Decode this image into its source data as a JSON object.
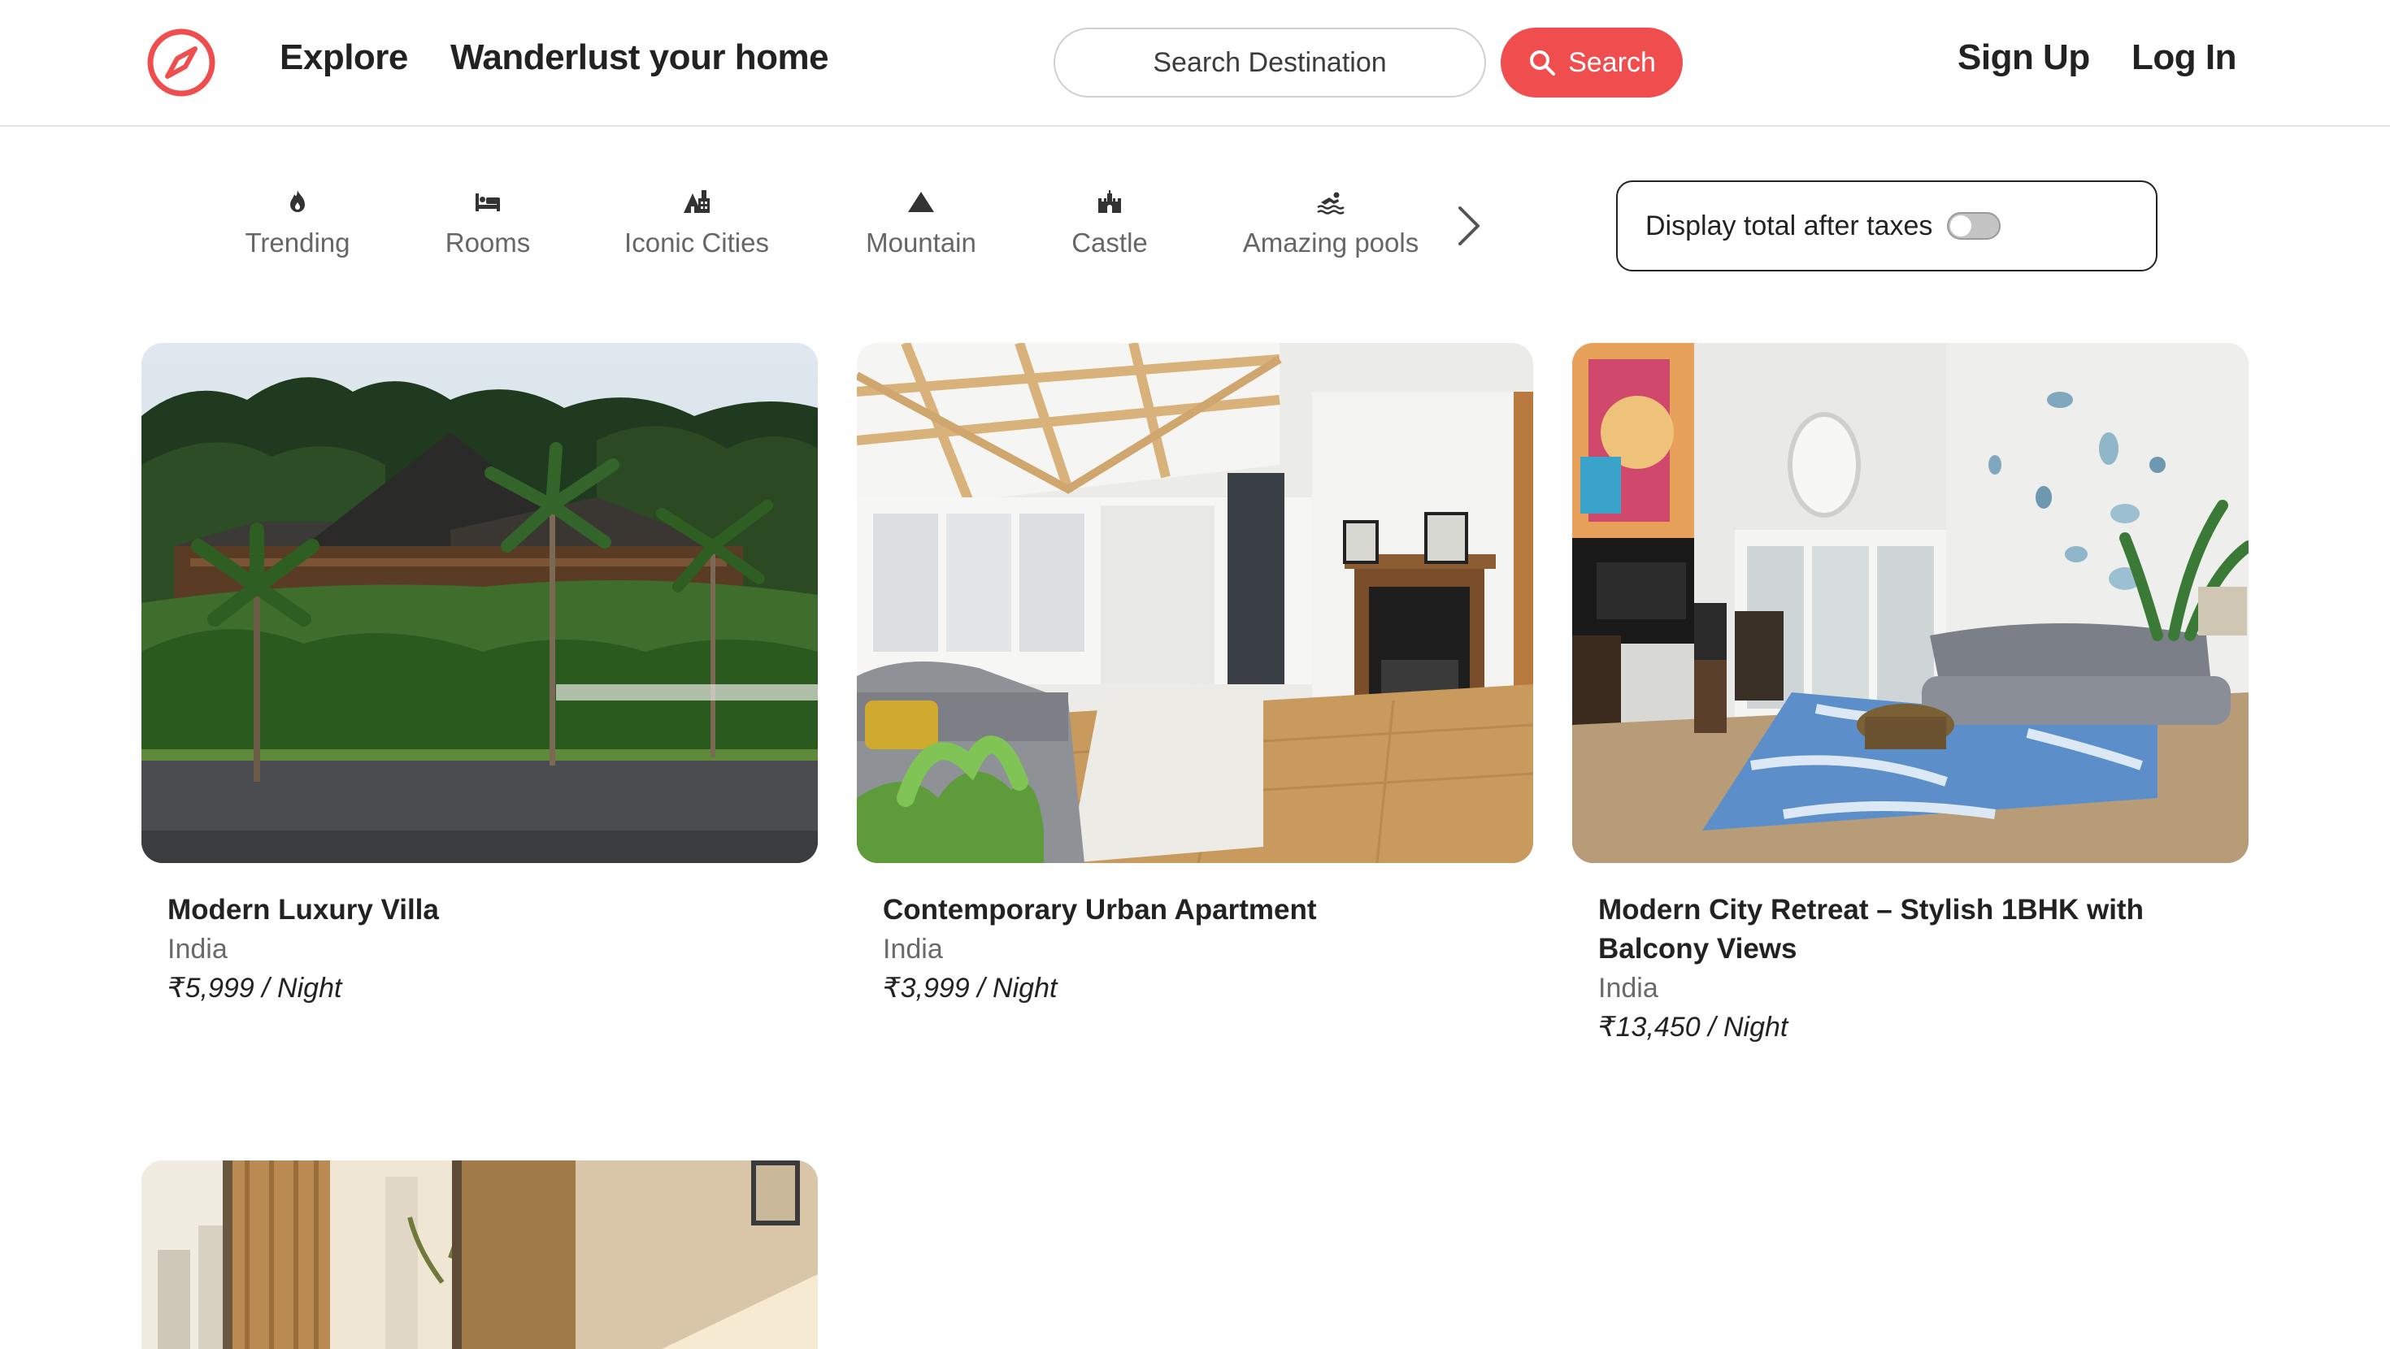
{
  "navbar": {
    "links": [
      "Explore",
      "Wanderlust your home"
    ],
    "search_placeholder": "Search Destination",
    "search_button": "Search",
    "auth": [
      "Sign Up",
      "Log In"
    ],
    "brand_color": "#f04e4e",
    "logo_icon": "compass-icon"
  },
  "filters": {
    "items": [
      {
        "label": "Trending",
        "icon": "fire-icon"
      },
      {
        "label": "Rooms",
        "icon": "bed-icon"
      },
      {
        "label": "Iconic Cities",
        "icon": "city-icon"
      },
      {
        "label": "Mountain",
        "icon": "mountain-icon"
      },
      {
        "label": "Castle",
        "icon": "castle-icon"
      },
      {
        "label": "Amazing pools",
        "icon": "swimmer-icon"
      }
    ],
    "next_icon": "chevron-right-icon",
    "tax_toggle_label": "Display total after taxes",
    "tax_toggle_on": false
  },
  "listings": [
    {
      "title": "Modern Luxury Villa",
      "location": "India",
      "price": "₹5,999 / Night"
    },
    {
      "title": "Contemporary Urban Apartment",
      "location": "India",
      "price": "₹3,999 / Night"
    },
    {
      "title": "Modern City Retreat – Stylish 1BHK with Balcony Views",
      "location": "India",
      "price": "₹13,450 / Night"
    },
    {
      "title": "",
      "location": "",
      "price": ""
    }
  ]
}
